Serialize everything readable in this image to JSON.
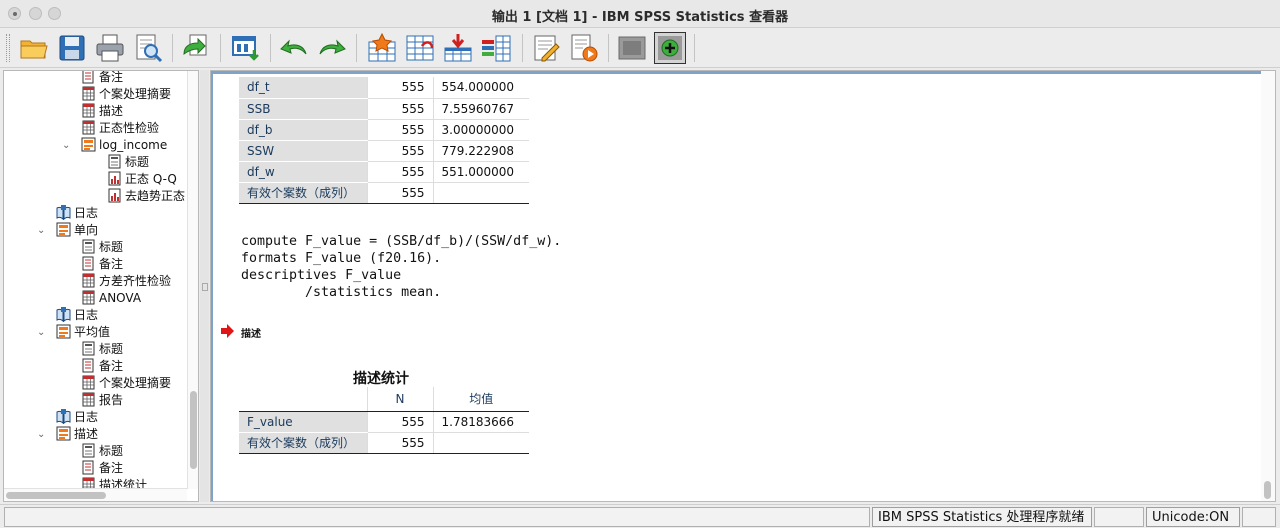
{
  "window": {
    "title": "输出 1 [文档 1] - IBM SPSS Statistics 查看器"
  },
  "toolbar": {
    "buttons": [
      {
        "name": "open-icon",
        "tip": "打开"
      },
      {
        "name": "save-icon",
        "tip": "保存"
      },
      {
        "name": "print-icon",
        "tip": "打印"
      },
      {
        "name": "print-preview-icon",
        "tip": "打印预览"
      },
      {
        "name": "export-icon",
        "tip": "导出"
      },
      {
        "name": "recall-dialog-icon",
        "tip": "重新调用对话框"
      },
      {
        "name": "undo-icon",
        "tip": "撤消"
      },
      {
        "name": "redo-icon",
        "tip": "重做"
      },
      {
        "name": "goto-data-icon",
        "tip": "转到数据"
      },
      {
        "name": "goto-case-icon",
        "tip": "转到个案"
      },
      {
        "name": "insert-variable-icon",
        "tip": "插入"
      },
      {
        "name": "variables-icon",
        "tip": "变量"
      },
      {
        "name": "edit-output-icon",
        "tip": "编辑"
      },
      {
        "name": "run-script-icon",
        "tip": "运行脚本"
      },
      {
        "name": "hide-icon",
        "tip": "隐藏"
      },
      {
        "name": "show-icon",
        "tip": "显示"
      }
    ]
  },
  "outline": {
    "items": [
      {
        "label": "备注",
        "icon": "notes-icon",
        "depth": 2
      },
      {
        "label": "个案处理摘要",
        "icon": "table-icon",
        "depth": 2
      },
      {
        "label": "描述",
        "icon": "table-icon",
        "depth": 2
      },
      {
        "label": "正态性检验",
        "icon": "table-icon",
        "depth": 2
      },
      {
        "label": "log_income",
        "icon": "folder-icon",
        "depth": 2,
        "expanded": true
      },
      {
        "label": "标题",
        "icon": "title-icon",
        "depth": 3
      },
      {
        "label": "正态 Q-Q",
        "icon": "chart-icon",
        "depth": 3
      },
      {
        "label": "去趋势正态",
        "icon": "chart-icon",
        "depth": 3
      },
      {
        "label": "日志",
        "icon": "log-icon",
        "depth": 1
      },
      {
        "label": "单向",
        "icon": "folder-icon",
        "depth": 1,
        "expanded": true
      },
      {
        "label": "标题",
        "icon": "title-icon",
        "depth": 2
      },
      {
        "label": "备注",
        "icon": "notes-icon",
        "depth": 2
      },
      {
        "label": "方差齐性检验",
        "icon": "table-icon",
        "depth": 2
      },
      {
        "label": "ANOVA",
        "icon": "table-icon",
        "depth": 2
      },
      {
        "label": "日志",
        "icon": "log-icon",
        "depth": 1
      },
      {
        "label": "平均值",
        "icon": "folder-icon",
        "depth": 1,
        "expanded": true
      },
      {
        "label": "标题",
        "icon": "title-icon",
        "depth": 2
      },
      {
        "label": "备注",
        "icon": "notes-icon",
        "depth": 2
      },
      {
        "label": "个案处理摘要",
        "icon": "table-icon",
        "depth": 2
      },
      {
        "label": "报告",
        "icon": "table-icon",
        "depth": 2
      },
      {
        "label": "日志",
        "icon": "log-icon",
        "depth": 1
      },
      {
        "label": "描述",
        "icon": "folder-icon",
        "depth": 1,
        "expanded": true
      },
      {
        "label": "标题",
        "icon": "title-icon",
        "depth": 2
      },
      {
        "label": "备注",
        "icon": "notes-icon",
        "depth": 2
      },
      {
        "label": "描述统计",
        "icon": "table-icon",
        "depth": 2
      }
    ]
  },
  "upper_table": {
    "rows": [
      {
        "label": "df_t",
        "n": "555",
        "value": "554.000000"
      },
      {
        "label": "SSB",
        "n": "555",
        "value": "7.55960767"
      },
      {
        "label": "df_b",
        "n": "555",
        "value": "3.00000000"
      },
      {
        "label": "SSW",
        "n": "555",
        "value": "779.222908"
      },
      {
        "label": "df_w",
        "n": "555",
        "value": "551.000000"
      },
      {
        "label": "有效个案数（成列）",
        "n": "555",
        "value": ""
      }
    ]
  },
  "syntax": {
    "lines": [
      "compute F_value = (SSB/df_b)/(SSW/df_w).",
      "formats F_value (f20.16).",
      "descriptives F_value",
      "        /statistics mean."
    ]
  },
  "section": {
    "label": "描述"
  },
  "desc_table": {
    "title": "描述统计",
    "col_n": "N",
    "col_mean": "均值",
    "rows": [
      {
        "label": "F_value",
        "n": "555",
        "value": "1.78183666"
      },
      {
        "label": "有效个案数（成列）",
        "n": "555",
        "value": ""
      }
    ]
  },
  "status": {
    "processor": "IBM SPSS Statistics 处理程序就绪",
    "unicode": "Unicode:ON"
  }
}
